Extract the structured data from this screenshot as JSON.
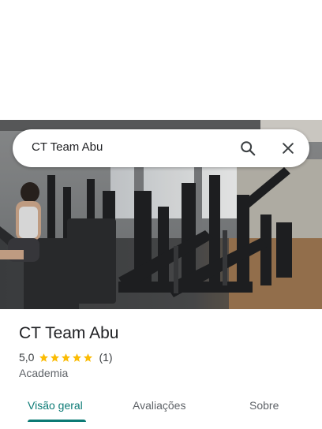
{
  "search": {
    "query": "CT Team Abu",
    "search_icon": "search-icon",
    "close_icon": "close-icon"
  },
  "photo": {
    "subject": "gym-photo"
  },
  "place": {
    "name": "CT Team Abu",
    "rating": "5,0",
    "stars": 5,
    "review_count": "(1)",
    "category": "Academia"
  },
  "tabs": [
    {
      "label": "Visão geral",
      "active": true
    },
    {
      "label": "Avaliações",
      "active": false
    },
    {
      "label": "Sobre",
      "active": false
    }
  ],
  "colors": {
    "accent": "#0b7a75",
    "star": "#fbbc04",
    "text": "#202124",
    "secondary": "#5f6368"
  }
}
